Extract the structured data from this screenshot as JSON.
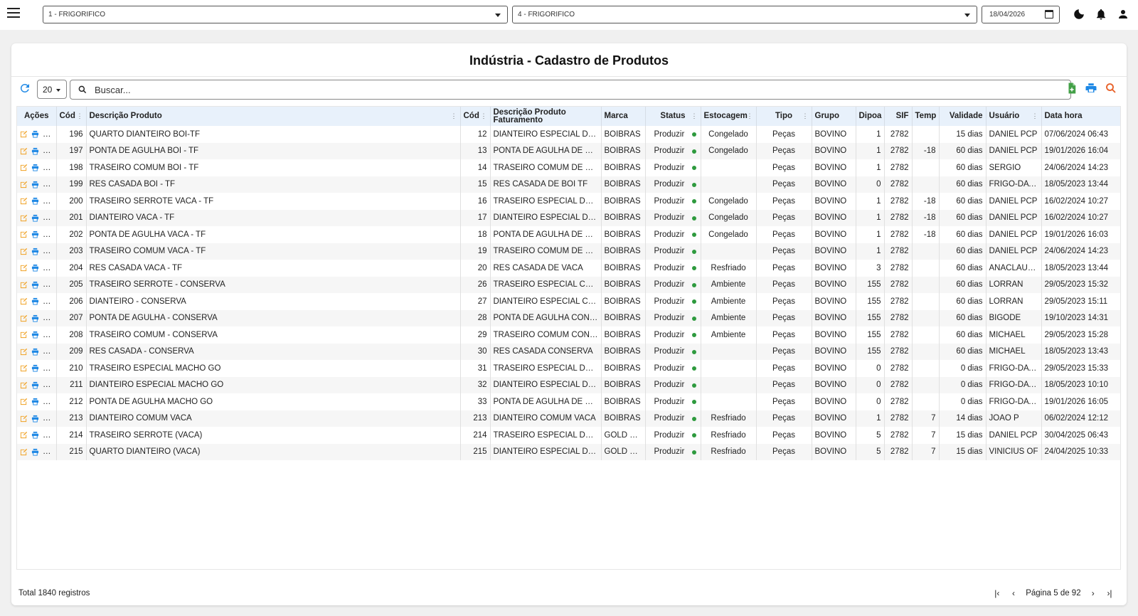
{
  "topbar": {
    "company_select": "1 - FRIGORIFICO",
    "unit_select": "4 - FRIGORIFICO",
    "date": "18/04/2026"
  },
  "page": {
    "title": "Indústria - Cadastro de Produtos"
  },
  "toolbar": {
    "page_size": "20",
    "search_placeholder": "Buscar..."
  },
  "table": {
    "headers": {
      "acoes": "Ações",
      "cod": "Cód",
      "descricao": "Descrição Produto",
      "cod_fat": "Cód",
      "descricao_fat": "Descrição Produto Faturamento",
      "marca": "Marca",
      "status": "Status",
      "estocagem": "Estocagem",
      "tipo": "Tipo",
      "grupo": "Grupo",
      "dipoa": "Dipoa",
      "sif": "SIF",
      "temp": "Temp",
      "validade": "Validade",
      "usuario": "Usuário",
      "data_hora": "Data hora"
    },
    "rows": [
      [
        "196",
        "QUARTO DIANTEIRO BOI-TF",
        "12",
        "DIANTEIRO ESPECIAL DE B...",
        "BOIBRAS",
        "Produzir",
        "Congelado",
        "Peças",
        "BOVINO",
        "1",
        "2782",
        "",
        "15 dias",
        "DANIEL PCP",
        "07/06/2024 06:43"
      ],
      [
        "197",
        "PONTA DE AGULHA BOI - TF",
        "13",
        "PONTA DE AGULHA DE BOI...",
        "BOIBRAS",
        "Produzir",
        "Congelado",
        "Peças",
        "BOVINO",
        "1",
        "2782",
        "-18",
        "60 dias",
        "DANIEL PCP",
        "19/01/2026 16:04"
      ],
      [
        "198",
        "TRASEIRO COMUM BOI  - TF",
        "14",
        "TRASEIRO COMUM DE BOI ...",
        "BOIBRAS",
        "Produzir",
        "",
        "Peças",
        "BOVINO",
        "1",
        "2782",
        "",
        "60 dias",
        "SERGIO",
        "24/06/2024 14:23"
      ],
      [
        "199",
        "RES CASADA BOI - TF",
        "15",
        "RES CASADA DE BOI TF",
        "BOIBRAS",
        "Produzir",
        "",
        "Peças",
        "BOVINO",
        "0",
        "2782",
        "",
        "60 dias",
        "FRIGO-DATA",
        "18/05/2023 13:44"
      ],
      [
        "200",
        "TRASEIRO SERROTE VACA -  TF",
        "16",
        "TRASEIRO ESPECIAL DE VA...",
        "BOIBRAS",
        "Produzir",
        "Congelado",
        "Peças",
        "BOVINO",
        "1",
        "2782",
        "-18",
        "60 dias",
        "DANIEL PCP",
        "16/02/2024 10:27"
      ],
      [
        "201",
        "DIANTEIRO VACA - TF",
        "17",
        "DIANTEIRO ESPECIAL DE V...",
        "BOIBRAS",
        "Produzir",
        "Congelado",
        "Peças",
        "BOVINO",
        "1",
        "2782",
        "-18",
        "60 dias",
        "DANIEL PCP",
        "16/02/2024 10:27"
      ],
      [
        "202",
        "PONTA DE AGULHA VACA - TF",
        "18",
        "PONTA DE AGULHA DE VA...",
        "BOIBRAS",
        "Produzir",
        "Congelado",
        "Peças",
        "BOVINO",
        "1",
        "2782",
        "-18",
        "60 dias",
        "DANIEL PCP",
        "19/01/2026 16:03"
      ],
      [
        "203",
        "TRASEIRO COMUM VACA - TF",
        "19",
        "TRASEIRO COMUM DE VAC...",
        "BOIBRAS",
        "Produzir",
        "",
        "Peças",
        "BOVINO",
        "1",
        "2782",
        "",
        "60 dias",
        "DANIEL PCP",
        "24/06/2024 14:23"
      ],
      [
        "204",
        "RES CASADA VACA - TF",
        "20",
        "RES CASADA DE VACA",
        "BOIBRAS",
        "Produzir",
        "Resfriado",
        "Peças",
        "BOVINO",
        "3",
        "2782",
        "",
        "60 dias",
        "ANACLAUD...",
        "18/05/2023 13:44"
      ],
      [
        "205",
        "TRASEIRO SERROTE - CONSERVA",
        "26",
        "TRASEIRO ESPECIAL CONS...",
        "BOIBRAS",
        "Produzir",
        "Ambiente",
        "Peças",
        "BOVINO",
        "155",
        "2782",
        "",
        "60 dias",
        "LORRAN",
        "29/05/2023 15:32"
      ],
      [
        "206",
        "DIANTEIRO - CONSERVA",
        "27",
        "DIANTEIRO ESPECIAL CON...",
        "BOIBRAS",
        "Produzir",
        "Ambiente",
        "Peças",
        "BOVINO",
        "155",
        "2782",
        "",
        "60 dias",
        "LORRAN",
        "29/05/2023 15:11"
      ],
      [
        "207",
        "PONTA DE AGULHA - CONSERVA",
        "28",
        "PONTA DE AGULHA CONSE...",
        "BOIBRAS",
        "Produzir",
        "Ambiente",
        "Peças",
        "BOVINO",
        "155",
        "2782",
        "",
        "60 dias",
        "BIGODE",
        "19/10/2023 14:31"
      ],
      [
        "208",
        "TRASEIRO COMUM - CONSERVA",
        "29",
        "TRASEIRO COMUM CONSE...",
        "BOIBRAS",
        "Produzir",
        "Ambiente",
        "Peças",
        "BOVINO",
        "155",
        "2782",
        "",
        "60 dias",
        "MICHAEL",
        "29/05/2023 15:28"
      ],
      [
        "209",
        "RES CASADA - CONSERVA",
        "30",
        "RES CASADA CONSERVA",
        "BOIBRAS",
        "Produzir",
        "",
        "Peças",
        "BOVINO",
        "155",
        "2782",
        "",
        "60 dias",
        "MICHAEL",
        "18/05/2023 13:43"
      ],
      [
        "210",
        "TRASEIRO ESPECIAL MACHO GO",
        "31",
        "TRASEIRO ESPECIAL DE M...",
        "BOIBRAS",
        "Produzir",
        "",
        "Peças",
        "BOVINO",
        "0",
        "2782",
        "",
        "0 dias",
        "FRIGO-DATA",
        "29/05/2023 15:33"
      ],
      [
        "211",
        "DIANTEIRO ESPECIAL MACHO GO",
        "32",
        "DIANTEIRO ESPECIAL DE ...",
        "BOIBRAS",
        "Produzir",
        "",
        "Peças",
        "BOVINO",
        "0",
        "2782",
        "",
        "0 dias",
        "FRIGO-DATA",
        "18/05/2023 10:10"
      ],
      [
        "212",
        "PONTA DE AGULHA MACHO GO",
        "33",
        "PONTA DE AGULHA DE MA...",
        "BOIBRAS",
        "Produzir",
        "",
        "Peças",
        "BOVINO",
        "0",
        "2782",
        "",
        "0 dias",
        "FRIGO-DATA",
        "19/01/2026 16:05"
      ],
      [
        "213",
        "DIANTEIRO COMUM VACA",
        "213",
        "DIANTEIRO COMUM VACA",
        "BOIBRAS",
        "Produzir",
        "Resfriado",
        "Peças",
        "BOVINO",
        "1",
        "2782",
        "7",
        "14 dias",
        "JOAO P",
        "06/02/2024 12:12"
      ],
      [
        "214",
        "TRASEIRO SERROTE (VACA)",
        "214",
        "TRASEIRO ESPECIAL DE VA...",
        "GOLD BE...",
        "Produzir",
        "Resfriado",
        "Peças",
        "BOVINO",
        "5",
        "2782",
        "7",
        "15 dias",
        "DANIEL PCP",
        "30/04/2025 06:43"
      ],
      [
        "215",
        "QUARTO DIANTEIRO (VACA)",
        "215",
        "DIANTEIRO ESPECIAL DE V...",
        "GOLD BE...",
        "Produzir",
        "Resfriado",
        "Peças",
        "BOVINO",
        "5",
        "2782",
        "7",
        "15 dias",
        "VINICIUS OF",
        "24/04/2025 10:33"
      ]
    ]
  },
  "footer": {
    "total": "Total 1840 registros",
    "page_label": "Página 5 de 92"
  },
  "colors": {
    "edit_icon": "#f0a020",
    "print_icon": "#1e88e5",
    "copy_icon": "#43a047",
    "status_dot": "#2e9a3e",
    "header_bg": "#e8f1fb",
    "excel_icon": "#43a047",
    "search_icon": "#e8622a"
  }
}
